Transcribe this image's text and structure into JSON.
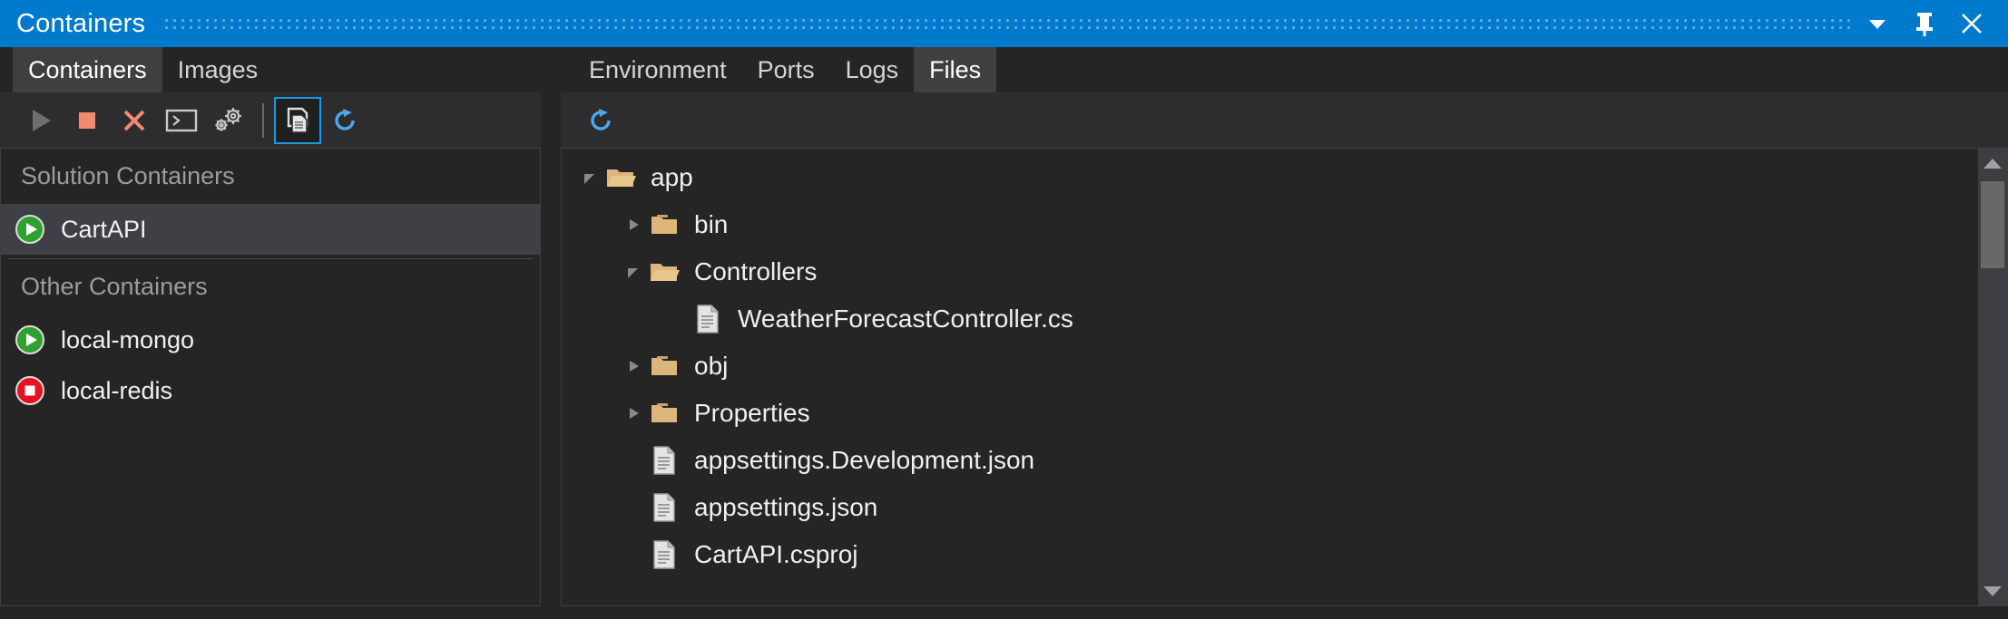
{
  "window": {
    "title": "Containers",
    "controls": [
      {
        "name": "dropdown-chevron",
        "label": "Window options"
      },
      {
        "name": "pin",
        "label": "Auto Hide"
      },
      {
        "name": "close",
        "label": "Close"
      }
    ],
    "accent_color": "#007ACC"
  },
  "left_panel": {
    "tabs": [
      {
        "label": "Containers",
        "active": true
      },
      {
        "label": "Images",
        "active": false
      }
    ],
    "toolbar": [
      {
        "name": "start-button",
        "label": "Start",
        "icon": "play-icon",
        "color": "#6E6E6E",
        "enabled": false,
        "selected": false
      },
      {
        "name": "stop-button",
        "label": "Stop",
        "icon": "stop-square-icon",
        "color": "#F08A70",
        "enabled": true,
        "selected": false
      },
      {
        "name": "remove-button",
        "label": "Remove",
        "icon": "close-x-icon",
        "color": "#F08A70",
        "enabled": true,
        "selected": false
      },
      {
        "name": "terminal-button",
        "label": "Open Terminal Window",
        "icon": "terminal-icon",
        "color": "#C8C8C8",
        "enabled": true,
        "selected": false
      },
      {
        "name": "settings-button",
        "label": "Settings",
        "icon": "gears-icon",
        "color": "#C8C8C8",
        "enabled": true,
        "selected": false
      },
      {
        "name": "view-files-button",
        "label": "View Files",
        "icon": "documents-icon",
        "color": "#DCDCDC",
        "enabled": true,
        "selected": true
      },
      {
        "name": "refresh-button",
        "label": "Refresh",
        "icon": "refresh-icon",
        "color": "#4FA7E8",
        "enabled": true,
        "selected": false
      }
    ],
    "groups": [
      {
        "name": "solution-containers",
        "header": "Solution Containers",
        "items": [
          {
            "label": "CartAPI",
            "state": "running",
            "state_icon": "play-circle-icon",
            "state_color": "#2EA12E",
            "selected": true
          }
        ]
      },
      {
        "name": "other-containers",
        "header": "Other Containers",
        "items": [
          {
            "label": "local-mongo",
            "state": "running",
            "state_icon": "play-circle-icon",
            "state_color": "#2EA12E",
            "selected": false
          },
          {
            "label": "local-redis",
            "state": "stopped",
            "state_icon": "stop-circle-icon",
            "state_color": "#E81123",
            "selected": false
          }
        ]
      }
    ]
  },
  "right_panel": {
    "tabs": [
      {
        "label": "Environment",
        "active": false
      },
      {
        "label": "Ports",
        "active": false
      },
      {
        "label": "Logs",
        "active": false
      },
      {
        "label": "Files",
        "active": true
      }
    ],
    "toolbar": [
      {
        "name": "refresh-files-button",
        "label": "Refresh",
        "icon": "refresh-icon",
        "color": "#4FA7E8"
      }
    ],
    "file_tree": [
      {
        "label": "app",
        "type": "folder",
        "state": "expanded",
        "depth": 0
      },
      {
        "label": "bin",
        "type": "folder",
        "state": "collapsed",
        "depth": 1
      },
      {
        "label": "Controllers",
        "type": "folder",
        "state": "expanded",
        "depth": 1
      },
      {
        "label": "WeatherForecastController.cs",
        "type": "file",
        "state": "leaf",
        "depth": 2
      },
      {
        "label": "obj",
        "type": "folder",
        "state": "collapsed",
        "depth": 1
      },
      {
        "label": "Properties",
        "type": "folder",
        "state": "collapsed",
        "depth": 1
      },
      {
        "label": "appsettings.Development.json",
        "type": "file",
        "state": "leaf",
        "depth": 1
      },
      {
        "label": "appsettings.json",
        "type": "file",
        "state": "leaf",
        "depth": 1
      },
      {
        "label": "CartAPI.csproj",
        "type": "file",
        "state": "leaf",
        "depth": 1
      }
    ],
    "scrollbar": {
      "name": "files-vertical-scrollbar",
      "thumb_top_pct": 2,
      "thumb_height_pct": 22
    }
  },
  "colors": {
    "folder": "#DCB67A",
    "file": "#C5C5C5",
    "accent": "#007ACC",
    "panel_bg": "#252526",
    "toolbar_bg": "#2D2D30",
    "selected_row": "#3F3F46"
  }
}
